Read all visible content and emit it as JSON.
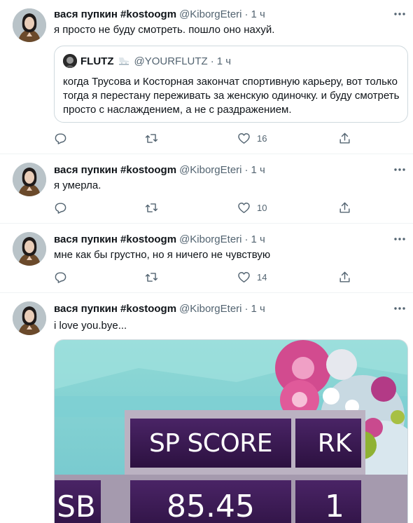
{
  "colors": {
    "text_primary": "#0f1419",
    "text_secondary": "#536471",
    "border": "#eff3f4",
    "score_panel": "#3a1a4f",
    "sky": "#7fcfd2"
  },
  "icons": {
    "reply": "speech-bubble-icon",
    "retweet": "retweet-arrows-icon",
    "like": "heart-icon",
    "share": "upload-arrow-icon",
    "more": "ellipsis-icon"
  },
  "tweets": [
    {
      "name": "вася пупкин #kostoogm",
      "handle": "@KiborgEteri",
      "dot": "·",
      "time": "1 ч",
      "text": "я просто не буду смотреть. пошло оно нахуй.",
      "quote": {
        "name": "FLUTZ",
        "handle": "@YOURFLUTZ",
        "dot": "·",
        "time": "1 ч",
        "text": "когда Трусова и Косторная закончат спортивную карьеру, вот только тогда я перестану переживать за женскую одиночку. и буду смотреть просто с наслаждением, а не с раздражением."
      },
      "likes": "16"
    },
    {
      "name": "вася пупкин #kostoogm",
      "handle": "@KiborgEteri",
      "dot": "·",
      "time": "1 ч",
      "text": "я умерла.",
      "likes": "10"
    },
    {
      "name": "вася пупкин #kostoogm",
      "handle": "@KiborgEteri",
      "dot": "·",
      "time": "1 ч",
      "text": "мне как бы грустно, но я ничего не чувствую",
      "likes": "14"
    },
    {
      "name": "вася пупкин #kostoogm",
      "handle": "@KiborgEteri",
      "dot": "·",
      "time": "1 ч",
      "text": "i love you.bye...",
      "media": {
        "score_label": "SP SCORE",
        "rank_label": "RK",
        "skater_code": "SB",
        "score": "85.45",
        "rank": "1"
      }
    }
  ]
}
